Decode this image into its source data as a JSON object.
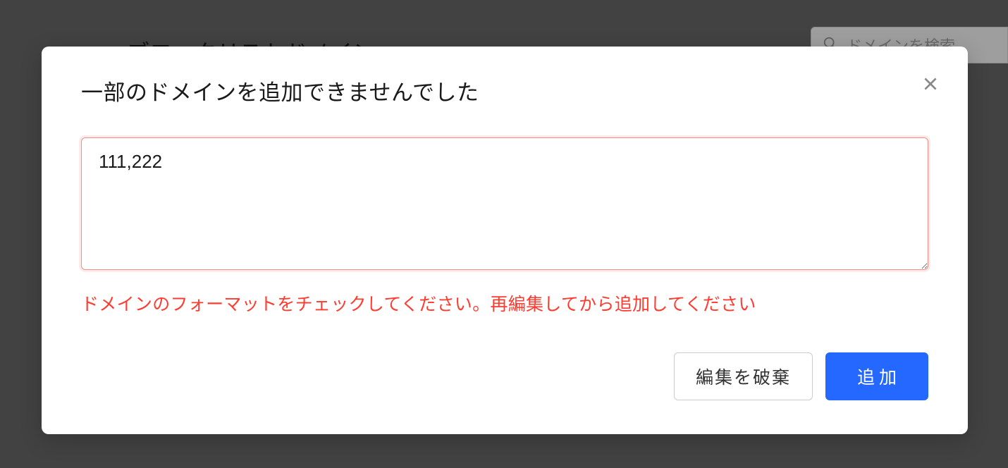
{
  "background": {
    "page_title": "ブロックリストドメイン",
    "search_placeholder": "ドメインを検索"
  },
  "modal": {
    "title": "一部のドメインを追加できませんでした",
    "textarea_value": "111,222",
    "error_message": "ドメインのフォーマットをチェックしてください。再編集してから追加してください",
    "discard_label": "編集を破棄",
    "add_label": "追加"
  },
  "colors": {
    "error": "#ff3b30",
    "primary": "#2468ff",
    "error_border": "#f58c8c"
  }
}
